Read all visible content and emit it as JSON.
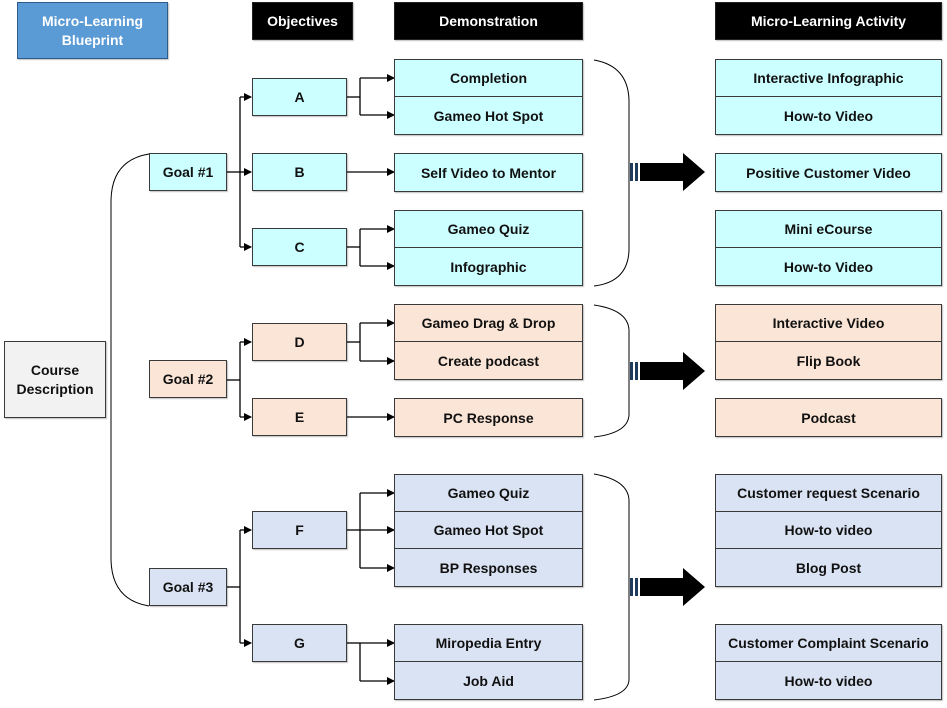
{
  "title": "Micro-Learning Blueprint",
  "headers": {
    "objectives": "Objectives",
    "demonstration": "Demonstration",
    "activity": "Micro-Learning Activity"
  },
  "course": "Course Description",
  "colors": {
    "goal1": "#ccffff",
    "goal2": "#fbe5d6",
    "goal3": "#dae3f3",
    "title_bg": "#5b9bd5",
    "header_bg": "#000000",
    "course_bg": "#f2f2f2"
  },
  "goals": [
    {
      "label": "Goal #1",
      "objectives": [
        {
          "label": "A",
          "demonstrations": [
            "Completion",
            "Gameo Hot Spot"
          ]
        },
        {
          "label": "B",
          "demonstrations": [
            "Self Video to Mentor"
          ]
        },
        {
          "label": "C",
          "demonstrations": [
            "Gameo Quiz",
            "Infographic"
          ]
        }
      ],
      "activities": [
        [
          "Interactive Infographic",
          "How-to Video"
        ],
        [
          "Positive Customer Video"
        ],
        [
          "Mini eCourse",
          "How-to Video"
        ]
      ]
    },
    {
      "label": "Goal #2",
      "objectives": [
        {
          "label": "D",
          "demonstrations": [
            "Gameo Drag &  Drop",
            "Create podcast"
          ]
        },
        {
          "label": "E",
          "demonstrations": [
            "PC Response"
          ]
        }
      ],
      "activities": [
        [
          "Interactive Video",
          "Flip Book"
        ],
        [
          "Podcast"
        ]
      ]
    },
    {
      "label": "Goal #3",
      "objectives": [
        {
          "label": "F",
          "demonstrations": [
            "Gameo Quiz",
            "Gameo Hot Spot",
            "BP Responses"
          ]
        },
        {
          "label": "G",
          "demonstrations": [
            "Miropedia Entry",
            "Job Aid"
          ]
        }
      ],
      "activities": [
        [
          "Customer request Scenario",
          "How-to video",
          "Blog Post"
        ],
        [
          "Customer Complaint Scenario",
          "How-to video"
        ]
      ]
    }
  ]
}
